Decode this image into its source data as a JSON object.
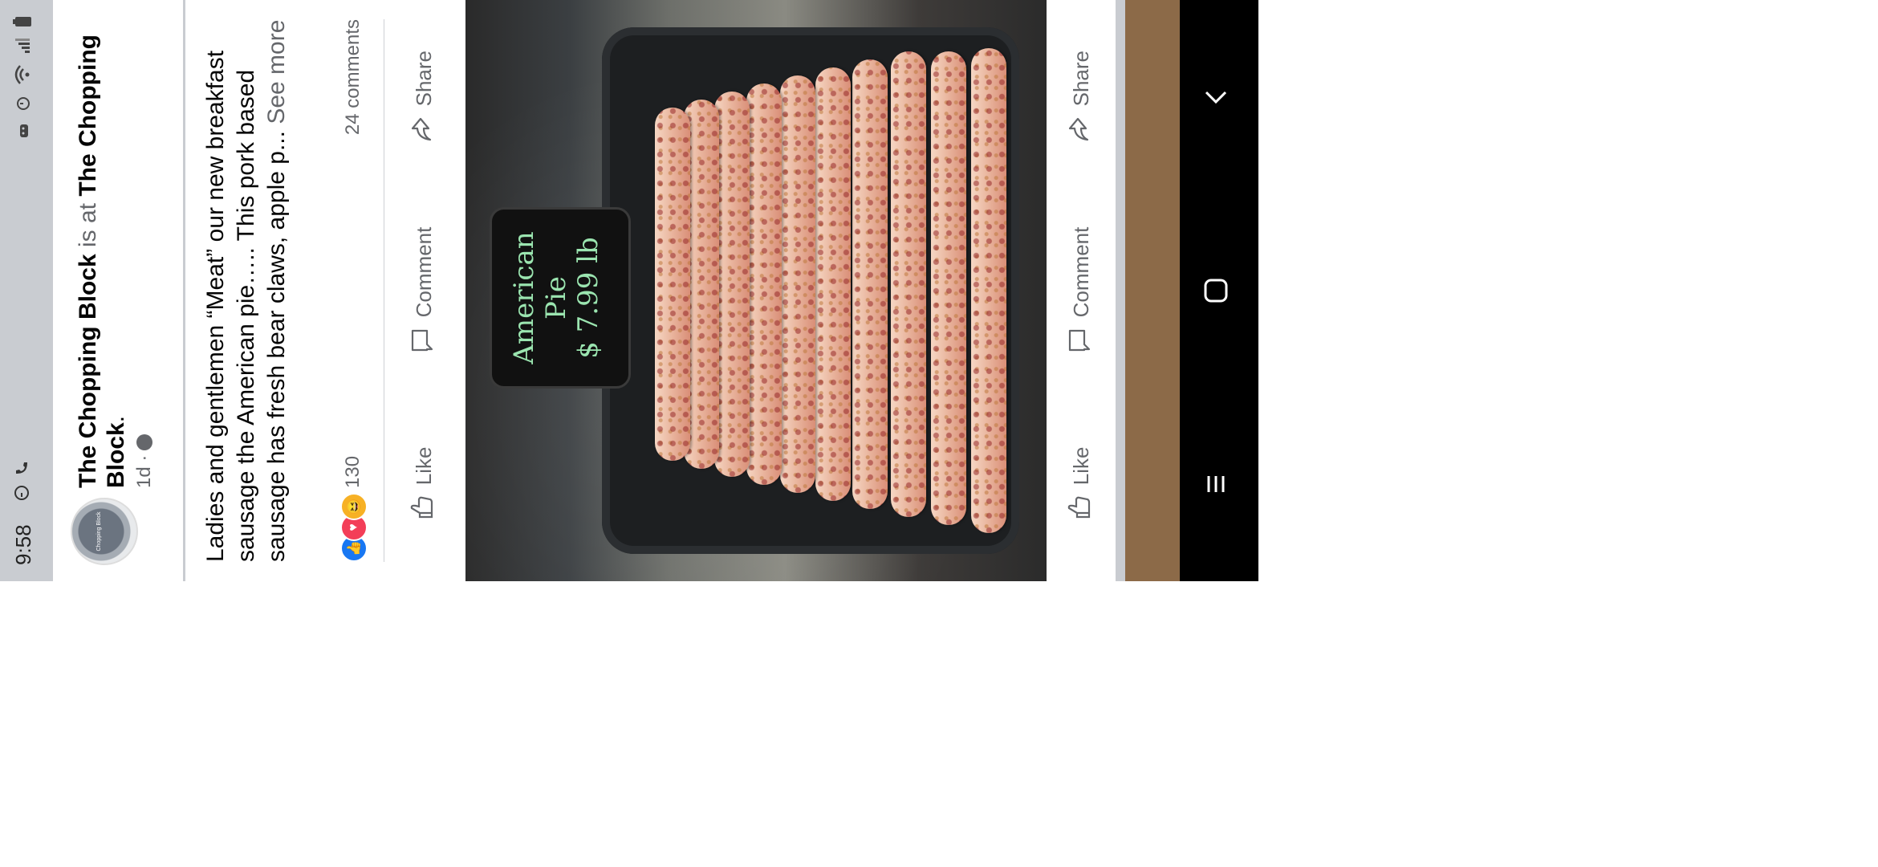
{
  "status": {
    "time": "9:58",
    "icons_left": [
      "alarm-icon",
      "call-forward-icon"
    ],
    "icons_right": [
      "battery-icon",
      "signal-icon",
      "wifi-icon",
      "alarm-clock-icon",
      "android-icon"
    ]
  },
  "post": {
    "author": "The Chopping Block",
    "connector": " is at ",
    "place": "The Chopping Block",
    "end": ".",
    "time": "1d ·",
    "avatar_text": "Chopping Block",
    "text": "Ladies and gentlemen “Meat” our new breakfast sausage the American pie….. This pork based sausage has fresh bear claws, apple p...",
    "see_more": "See more",
    "reaction_count": "130",
    "comments": "24 comments"
  },
  "actions": {
    "like": "Like",
    "comment": "Comment",
    "share": "Share"
  },
  "photo_sign": {
    "line1": "American",
    "line2": "Pie",
    "line3": "$ 7.99 lb"
  },
  "nav": {
    "recents": "|||",
    "home": "▢",
    "back": "‹"
  }
}
